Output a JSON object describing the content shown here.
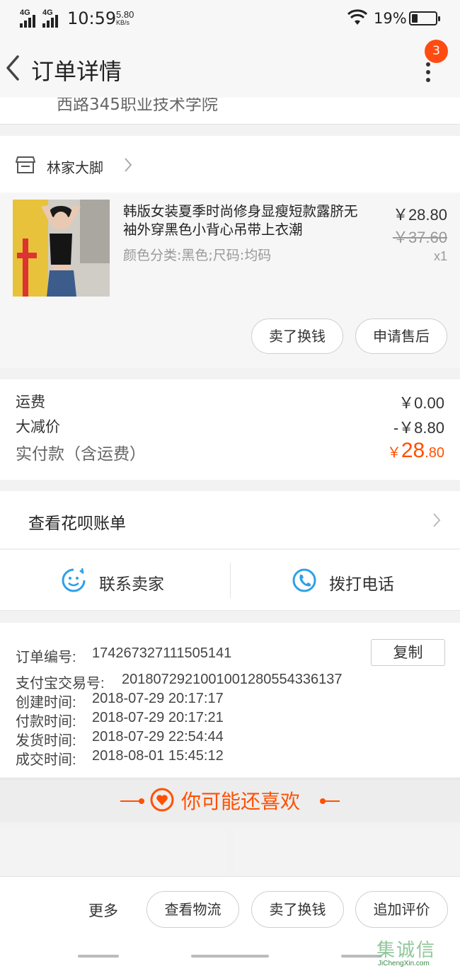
{
  "status_bar": {
    "signal1": "4G",
    "signal2": "4G",
    "time": "10:59",
    "speed_value": "5.80",
    "speed_unit": "KB/s",
    "battery": "19%"
  },
  "header": {
    "title": "订单详情",
    "badge_count": "3",
    "address_cut": "西路345职业技术学院"
  },
  "shop": {
    "name": "林家大脚"
  },
  "product": {
    "title": "韩版女装夏季时尚修身显瘦短款露脐无袖外穿黑色小背心吊带上衣潮",
    "sku": "颜色分类:黑色;尺码:均码",
    "price": "￥28.80",
    "original_price": "￥37.60",
    "quantity": "x1",
    "btn_resell": "卖了换钱",
    "btn_aftersale": "申请售后"
  },
  "price_summary": {
    "shipping_label": "运费",
    "shipping_value": "￥0.00",
    "discount_label": "大减价",
    "discount_value": "-￥8.80",
    "paid_label": "实付款（含运费）",
    "paid_symbol": "￥",
    "paid_int": "28",
    "paid_dec": ".80"
  },
  "huabei": {
    "label": "查看花呗账单"
  },
  "contact": {
    "seller": "联系卖家",
    "phone": "拨打电话"
  },
  "order_info": {
    "order_no_label": "订单编号:",
    "order_no": "174267327111505141",
    "copy_label": "复制",
    "alipay_label": "支付宝交易号:",
    "alipay_no": "2018072921001001280554336137",
    "created_label": "创建时间:",
    "created": "2018-07-29 20:17:17",
    "paid_label": "付款时间:",
    "paid": "2018-07-29 20:17:21",
    "shipped_label": "发货时间:",
    "shipped": "2018-07-29 22:54:44",
    "done_label": "成交时间:",
    "done": "2018-08-01 15:45:12"
  },
  "recommend": {
    "title": "你可能还喜欢"
  },
  "bottom_bar": {
    "more": "更多",
    "logistics": "查看物流",
    "resell": "卖了换钱",
    "review": "追加评价"
  },
  "watermark": {
    "text": "JiChengXin.com",
    "logo": "集诚信"
  },
  "colors": {
    "accent_orange": "#ff5000",
    "icon_blue": "#2fa0e6",
    "badge_red": "#ff4b12"
  }
}
